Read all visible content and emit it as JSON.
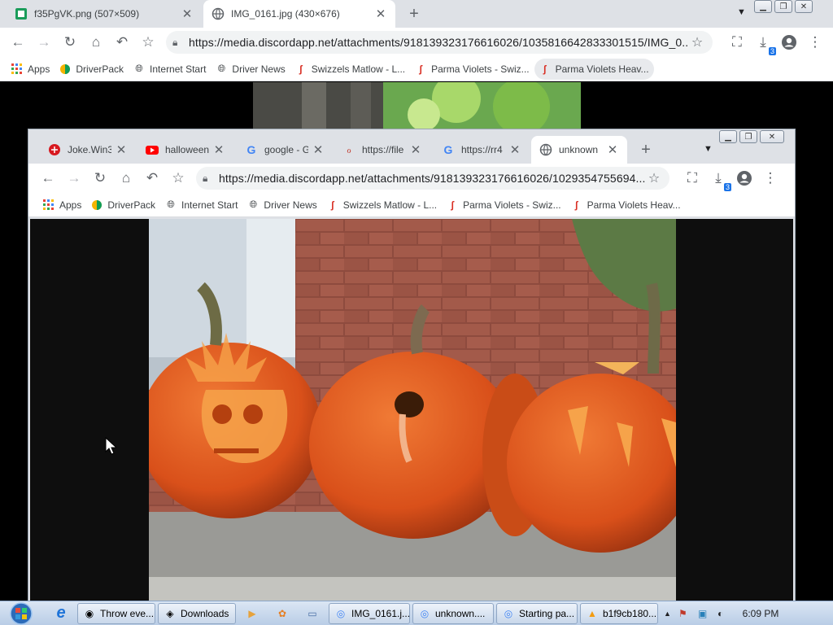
{
  "outer_window": {
    "tabs": [
      {
        "title": "f35PgVK.png (507×509)",
        "favicon": "image-favicon"
      },
      {
        "title": "IMG_0161.jpg (430×676)",
        "favicon": "globe-icon"
      }
    ],
    "url": "https://media.discordapp.net/attachments/918139323176616026/1035816642833301515/IMG_0...",
    "download_badge": "3",
    "bookmarks": [
      "Apps",
      "DriverPack",
      "Internet Start",
      "Driver News",
      "Swizzels Matlow - L...",
      "Parma Violets - Swiz...",
      "Parma Violets Heav..."
    ]
  },
  "inner_window": {
    "tabs": [
      {
        "title": "Joke.Win3",
        "favicon": "trend-micro-icon"
      },
      {
        "title": "halloween",
        "favicon": "youtube-icon"
      },
      {
        "title": "google - G",
        "favicon": "google-icon"
      },
      {
        "title": "https://file",
        "favicon": "file-favicon"
      },
      {
        "title": "https://rr4",
        "favicon": "google-icon"
      },
      {
        "title": "unknown",
        "favicon": "globe-icon"
      }
    ],
    "url": "https://media.discordapp.net/attachments/918139323176616026/1029354755694...",
    "download_badge": "3",
    "bookmarks": [
      "Apps",
      "DriverPack",
      "Internet Start",
      "Driver News",
      "Swizzels Matlow - L...",
      "Parma Violets - Swiz...",
      "Parma Violets Heav..."
    ]
  },
  "taskbar": {
    "items": [
      "Throw eve...",
      "Downloads",
      "IMG_0161.j...",
      "unknown....",
      "Starting pa...",
      "b1f9cb180..."
    ],
    "clock": "6:09 PM"
  },
  "colors": {
    "accent": "#1a73e8",
    "tab_strip": "#dee1e6",
    "pumpkin": "#e0561a"
  }
}
